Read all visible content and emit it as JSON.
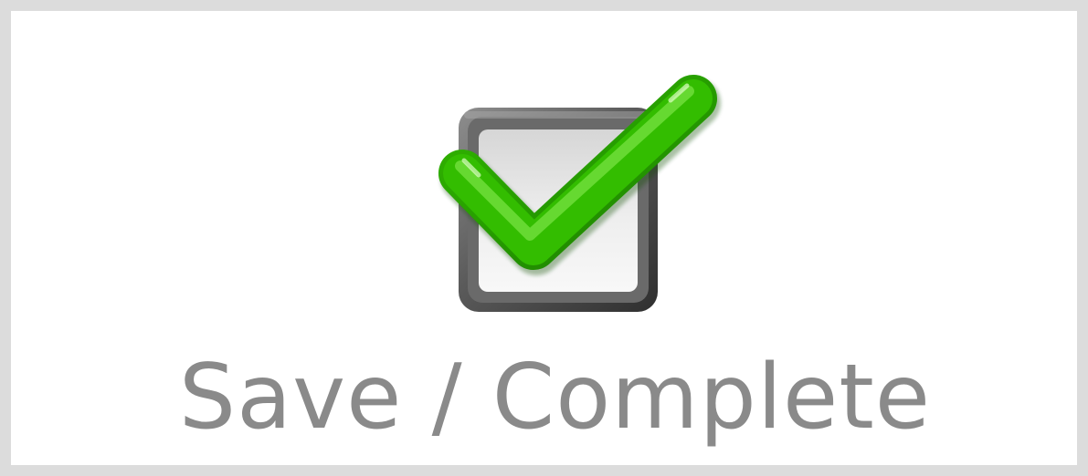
{
  "button": {
    "label": "Save / Complete",
    "icon": "checkbox-checked-icon",
    "colors": {
      "label_text": "#8a8a8a",
      "frame_border": "#dcdcdc",
      "check_green": "#2aa800",
      "check_highlight": "#7fe34a",
      "box_dark": "#4f4f4f",
      "box_light": "#efefef"
    }
  }
}
